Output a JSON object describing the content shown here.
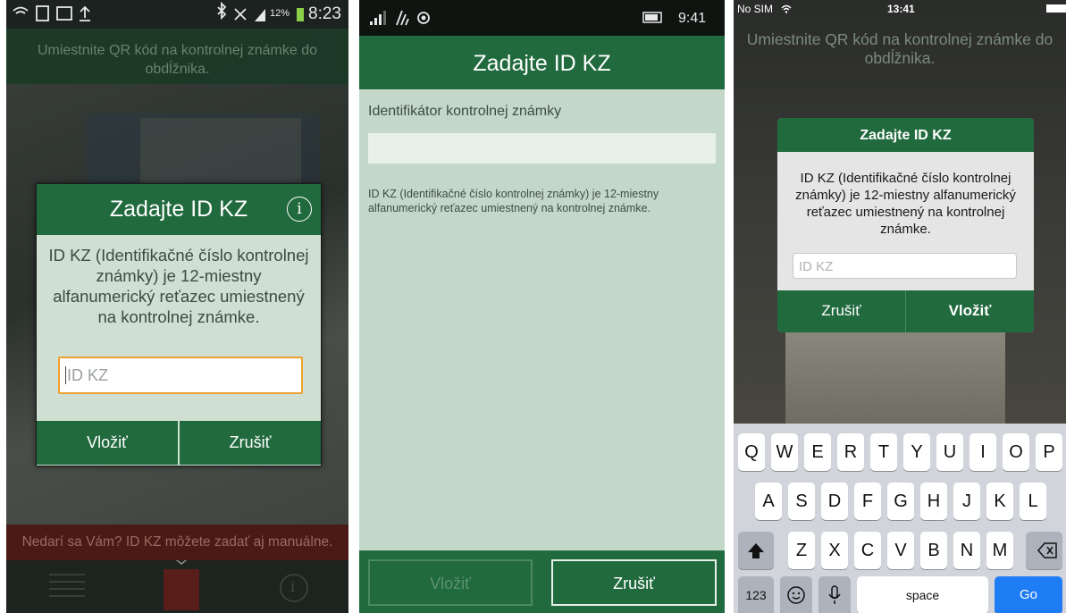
{
  "android": {
    "status": {
      "battery_pct": "12%",
      "time": "8:23"
    },
    "hint_top": "Umiestnite QR kód na kontrolnej známke do obdĺžnika.",
    "hint_bottom": "Nedarí sa Vám? ID KZ môžete zadať aj manuálne.",
    "dialog": {
      "title": "Zadajte ID KZ",
      "info_glyph": "i",
      "message": "ID KZ (Identifikačné číslo kontrolnej známky) je 12-miestny alfanumerický reťazec umiestnený na kontrolnej známke.",
      "input_placeholder": "ID KZ",
      "confirm_label": "Vložiť",
      "cancel_label": "Zrušiť"
    },
    "nav_info_glyph": "i"
  },
  "windows": {
    "status": {
      "time": "9:41"
    },
    "title": "Zadajte ID KZ",
    "field_label": "Identifikátor kontrolnej známky",
    "field_value": "",
    "description": "ID KZ (Identifikačné číslo kontrolnej známky) je 12-miestny alfanumerický reťazec umiestnený na kontrolnej známke.",
    "confirm_label": "Vložiť",
    "cancel_label": "Zrušiť"
  },
  "ios": {
    "status": {
      "carrier": "No SIM",
      "time": "13:41"
    },
    "hint": "Umiestnite QR kód na kontrolnej známke do obdĺžnika.",
    "alert": {
      "title": "Zadajte ID KZ",
      "message": "ID KZ (Identifikačné číslo kontrolnej známky) je 12-miestny alfanumerický reťazec umiestnený na kontrolnej známke.",
      "input_placeholder": "ID KZ",
      "cancel_label": "Zrušiť",
      "confirm_label": "Vložiť"
    },
    "keyboard": {
      "row1": [
        "Q",
        "W",
        "E",
        "R",
        "T",
        "Y",
        "U",
        "I",
        "O",
        "P"
      ],
      "row2": [
        "A",
        "S",
        "D",
        "F",
        "G",
        "H",
        "J",
        "K",
        "L"
      ],
      "row3": [
        "Z",
        "X",
        "C",
        "V",
        "B",
        "N",
        "M"
      ],
      "numbers_label": "123",
      "space_label": "space",
      "go_label": "Go"
    }
  },
  "colors": {
    "brand_green": "#216a3e",
    "focus_orange": "#f0a030",
    "ios_blue": "#1e7cf4"
  }
}
